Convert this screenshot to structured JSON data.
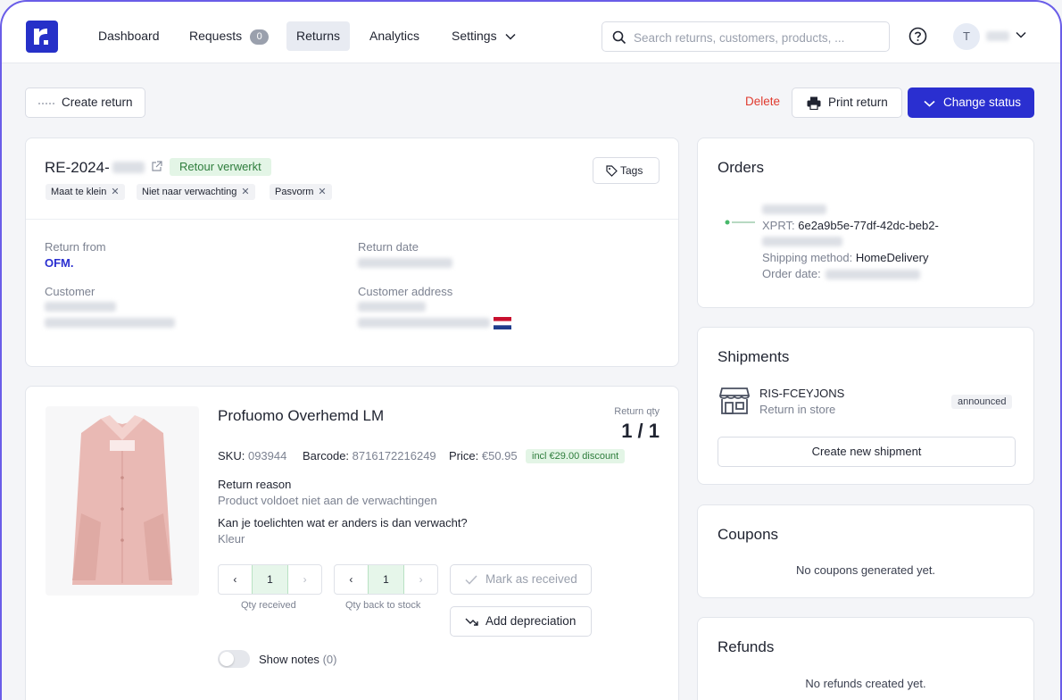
{
  "nav": {
    "items": [
      {
        "label": "Dashboard"
      },
      {
        "label": "Requests",
        "badge": "0"
      },
      {
        "label": "Returns"
      },
      {
        "label": "Analytics"
      },
      {
        "label": "Settings"
      }
    ],
    "active": "Returns",
    "search_placeholder": "Search returns, customers, products, ...",
    "user_initial": "T"
  },
  "actions": {
    "create_return": "Create return",
    "delete": "Delete",
    "print_return": "Print return",
    "change_status": "Change status"
  },
  "return": {
    "id": "RE-2024-",
    "status": "Retour verwerkt",
    "tags_button": "Tags",
    "tags": [
      "Maat te klein",
      "Niet naar verwachting",
      "Pasvorm"
    ],
    "return_from_label": "Return from",
    "return_from_value": "OFM.",
    "return_date_label": "Return date",
    "customer_label": "Customer",
    "customer_address_label": "Customer address"
  },
  "product": {
    "name": "Profuomo Overhemd LM",
    "return_qty_label": "Return qty",
    "return_qty": "1 / 1",
    "sku_label": "SKU:",
    "sku": "093944",
    "barcode_label": "Barcode:",
    "barcode": "8716172216249",
    "price_label": "Price:",
    "price": "€50.95",
    "discount": "incl €29.00 discount",
    "return_reason_label": "Return reason",
    "return_reason": "Product voldoet niet aan de verwachtingen",
    "question": "Kan je toelichten wat er anders is dan verwacht?",
    "answer": "Kleur",
    "qty_received": "1",
    "qty_received_label": "Qty received",
    "qty_stock": "1",
    "qty_stock_label": "Qty back to stock",
    "mark_received": "Mark as received",
    "add_depreciation": "Add depreciation",
    "show_notes": "Show notes",
    "notes_count": "(0)"
  },
  "orders": {
    "title": "Orders",
    "xprt_label": "XPRT:",
    "xprt_value": "6e2a9b5e-77df-42dc-beb2-",
    "shipping_label": "Shipping method:",
    "shipping_value": "HomeDelivery",
    "order_date_label": "Order date:"
  },
  "shipments": {
    "title": "Shipments",
    "code": "RIS-FCEYJONS",
    "method": "Return in store",
    "badge": "announced",
    "create_button": "Create new shipment"
  },
  "coupons": {
    "title": "Coupons",
    "empty": "No coupons generated yet."
  },
  "refunds": {
    "title": "Refunds",
    "empty": "No refunds created yet."
  },
  "colors": {
    "primary": "#2a2fd0",
    "delete": "#e03b2f",
    "success_bg": "#e3f5e6",
    "success_text": "#2e7d3c"
  }
}
